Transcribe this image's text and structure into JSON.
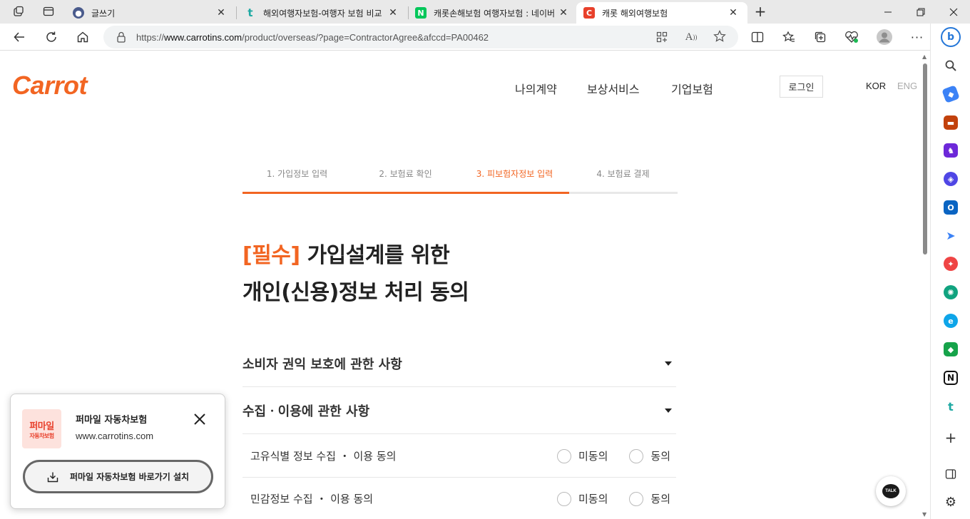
{
  "browser": {
    "tabs": [
      {
        "title": "글쓰기",
        "icon": "blog-icon",
        "color": "#4a5b8c"
      },
      {
        "title": "해외여행자보험-여행자 보험 비교",
        "icon": "tistory-icon",
        "color": "#1fa9a3"
      },
      {
        "title": "캐롯손해보험 여행자보험 : 네이버",
        "icon": "naver-icon",
        "color": "#03c75a"
      },
      {
        "title": "캐롯 해외여행보험",
        "icon": "carrot-icon",
        "color": "#e8402b"
      }
    ],
    "url_prefix": "https://",
    "url_host": "www.carrotins.com",
    "url_path": "/product/overseas/?page=ContractorAgree&afccd=PA00462"
  },
  "site": {
    "logo": "Carrot",
    "nav": [
      "나의계약",
      "보상서비스",
      "기업보험"
    ],
    "login": "로그인",
    "lang_kor": "KOR",
    "lang_eng": "ENG",
    "accent": "#f26522"
  },
  "steps": [
    "1. 가입정보 입력",
    "2. 보험료 확인",
    "3. 피보험자정보 입력",
    "4. 보험료 결제"
  ],
  "active_step": 3,
  "heading": {
    "required": "[필수]",
    "line1": " 가입설계를 위한",
    "line2": "개인(신용)정보 처리 동의"
  },
  "sections": [
    {
      "title": "소비자 권익 보호에 관한 사항"
    },
    {
      "title": "수집ㆍ이용에 관한 사항"
    }
  ],
  "agreements": [
    {
      "label": "고유식별 정보 수집 ・ 이용 동의",
      "disagree": "미동의",
      "agree": "동의"
    },
    {
      "label": "민감정보 수집 ・ 이용 동의",
      "disagree": "미동의",
      "agree": "동의"
    }
  ],
  "talk": "TALK",
  "popup": {
    "icon_line1": "퍼마일",
    "icon_line2": "자동차보험",
    "app_name": "퍼마일 자동차보험",
    "app_url": "www.carrotins.com",
    "install_label": "퍼마일 자동차보험 바로가기 설치"
  }
}
